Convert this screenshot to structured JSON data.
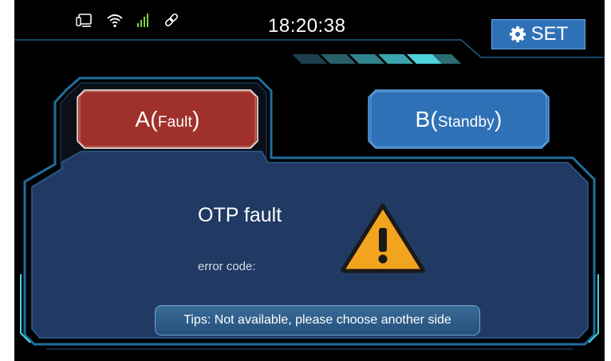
{
  "status_bar": {
    "icons": [
      "monitor-icon",
      "wifi-icon",
      "signal-bars-icon",
      "link-icon"
    ],
    "time": "18:20:38"
  },
  "set_button": {
    "label": "SET",
    "icon": "gear-icon"
  },
  "tabs": [
    {
      "main": "A(",
      "sub": "Fault",
      "close": ")",
      "state": "fault",
      "color": "#a8332c"
    },
    {
      "main": "B(",
      "sub": "Standby",
      "close": ")",
      "state": "standby",
      "color": "#2f71b7"
    }
  ],
  "panel": {
    "title": "OTP fault",
    "error_label": "error code:",
    "tips": "Tips: Not available, please choose another side",
    "warning_icon": "warning-triangle-icon",
    "warning_color": "#f3a41f"
  },
  "colors": {
    "background": "#000000",
    "panel": "#213a63",
    "frame": "#1e6f9e",
    "accent_cyan": "#4fd1de"
  }
}
